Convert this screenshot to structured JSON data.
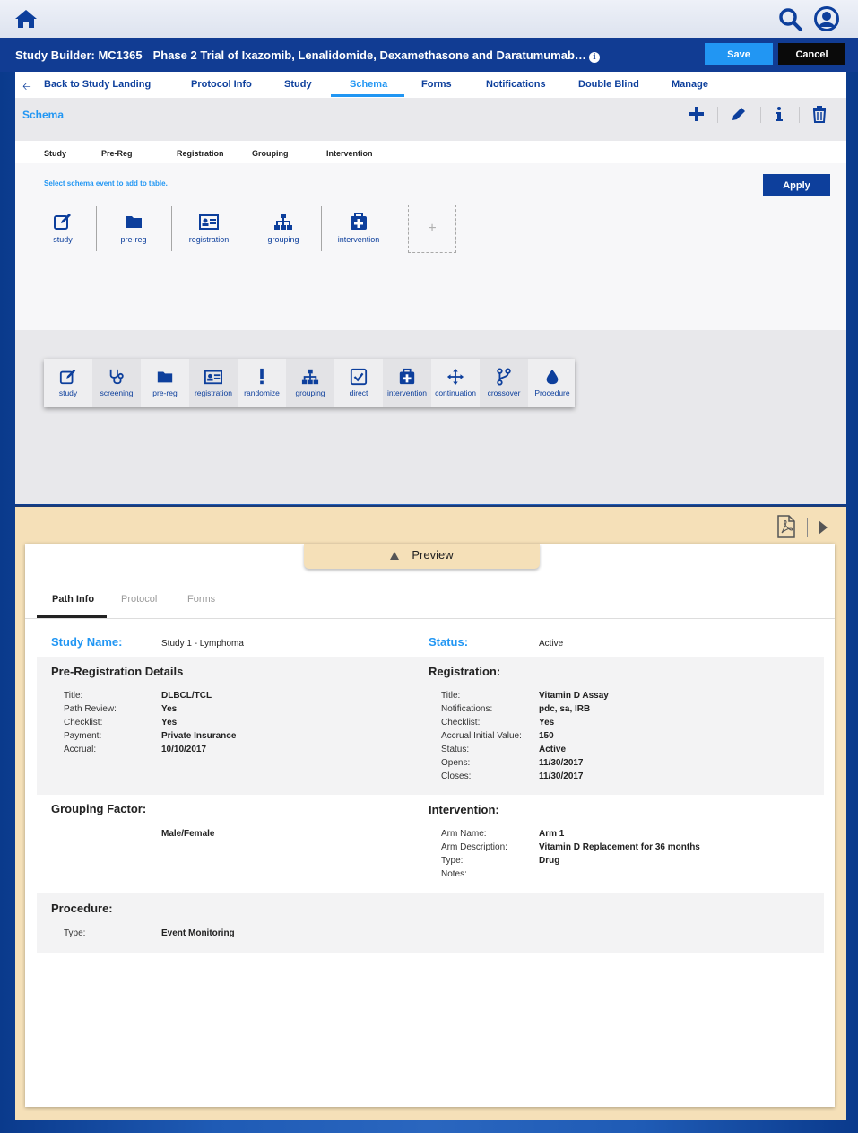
{
  "app": {
    "title_prefix": "Study Builder: MC1365",
    "title_text": "Phase 2 Trial of Ixazomib, Lenalidomide, Dexamethasone and Daratumumab…",
    "info_glyph": "i",
    "save_label": "Save",
    "cancel_label": "Cancel"
  },
  "nav": {
    "back_label": "Back to Study Landing",
    "tabs": [
      "Protocol Info",
      "Study",
      "Schema",
      "Forms",
      "Notifications",
      "Double Blind",
      "Manage"
    ],
    "active": "Schema"
  },
  "schema": {
    "title": "Schema",
    "columns": [
      "Study",
      "Pre-Reg",
      "Registration",
      "Grouping",
      "Intervention"
    ],
    "hint": "Select schema event to add to table.",
    "apply_label": "Apply",
    "chain": [
      "study",
      "pre-reg",
      "registration",
      "grouping",
      "intervention"
    ],
    "add_glyph": "+",
    "palette": [
      "study",
      "screening",
      "pre-reg",
      "registration",
      "randomize",
      "grouping",
      "direct",
      "intervention",
      "continuation",
      "crossover",
      "Procedure"
    ]
  },
  "preview": {
    "toggle_label": "Preview",
    "tabs": [
      "Path Info",
      "Protocol",
      "Forms"
    ],
    "active_tab": "Path Info",
    "study_name_label": "Study Name:",
    "study_name_value": "Study 1 - Lymphoma",
    "status_label": "Status:",
    "status_value": "Active",
    "prereg": {
      "heading": "Pre-Registration Details",
      "rows": [
        {
          "k": "Title:",
          "v": "DLBCL/TCL"
        },
        {
          "k": "Path Review:",
          "v": "Yes"
        },
        {
          "k": "Checklist:",
          "v": "Yes"
        },
        {
          "k": "Payment:",
          "v": "Private Insurance"
        },
        {
          "k": "Accrual:",
          "v": "10/10/2017"
        }
      ]
    },
    "registration": {
      "heading": "Registration:",
      "rows": [
        {
          "k": "Title:",
          "v": "Vitamin D Assay"
        },
        {
          "k": "Notifications:",
          "v": "pdc, sa, IRB"
        },
        {
          "k": "Checklist:",
          "v": "Yes"
        },
        {
          "k": "Accrual Initial Value:",
          "v": "150"
        },
        {
          "k": "Status:",
          "v": "Active"
        },
        {
          "k": "Opens:",
          "v": "11/30/2017"
        },
        {
          "k": "Closes:",
          "v": "11/30/2017"
        }
      ]
    },
    "grouping": {
      "heading": "Grouping Factor:",
      "value": "Male/Female"
    },
    "intervention": {
      "heading": "Intervention:",
      "rows": [
        {
          "k": "Arm Name:",
          "v": "Arm 1"
        },
        {
          "k": "Arm Description:",
          "v": "Vitamin D Replacement for 36 months"
        },
        {
          "k": "Type:",
          "v": "Drug"
        },
        {
          "k": "Notes:",
          "v": ""
        }
      ]
    },
    "procedure": {
      "heading": "Procedure:",
      "rows": [
        {
          "k": "Type:",
          "v": "Event Monitoring"
        }
      ]
    }
  },
  "colors": {
    "brand_dark": "#113c93",
    "accent": "#2196f3",
    "nav_text": "#0d3f9c",
    "preview_tan": "#f5e0b8"
  },
  "icons": {
    "top": [
      "home-icon",
      "search-icon",
      "user-icon"
    ],
    "toolbar": [
      "plus-icon",
      "pencil-icon",
      "info-icon",
      "trash-icon"
    ],
    "preview": [
      "pdf-icon",
      "play-icon"
    ]
  }
}
